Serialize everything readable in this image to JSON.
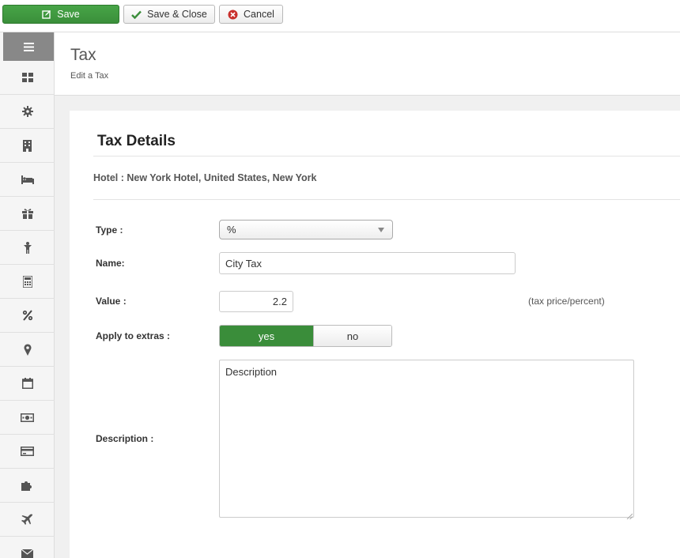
{
  "toolbar": {
    "save_label": "Save",
    "save_close_label": "Save & Close",
    "cancel_label": "Cancel"
  },
  "sidebar": {
    "toggle_icon": "menu-icon",
    "items": [
      {
        "icon": "dashboard-icon"
      },
      {
        "icon": "gear-icon"
      },
      {
        "icon": "building-icon"
      },
      {
        "icon": "bed-icon"
      },
      {
        "icon": "gift-icon"
      },
      {
        "icon": "person-icon"
      },
      {
        "icon": "calculator-icon"
      },
      {
        "icon": "percent-icon"
      },
      {
        "icon": "location-pin-icon"
      },
      {
        "icon": "calendar-icon"
      },
      {
        "icon": "money-icon"
      },
      {
        "icon": "credit-card-icon"
      },
      {
        "icon": "puzzle-icon"
      },
      {
        "icon": "plane-icon"
      },
      {
        "icon": "envelope-icon"
      }
    ]
  },
  "header": {
    "title": "Tax",
    "subtitle": "Edit a Tax"
  },
  "form": {
    "section_title": "Tax Details",
    "hotel_line": "Hotel : New York Hotel, United States, New York",
    "type_label": "Type :",
    "type_value": "%",
    "name_label": "Name:",
    "name_value": "City Tax",
    "value_label": "Value :",
    "value_value": "2.2",
    "value_hint": "(tax price/percent)",
    "extras_label": "Apply to extras :",
    "extras_yes": "yes",
    "extras_no": "no",
    "extras_selected": "yes",
    "description_label": "Description :",
    "description_value": "Description"
  },
  "colors": {
    "save_green": "#47a447",
    "toggle_green": "#3a8d3a",
    "sidebar_active": "#888888"
  }
}
